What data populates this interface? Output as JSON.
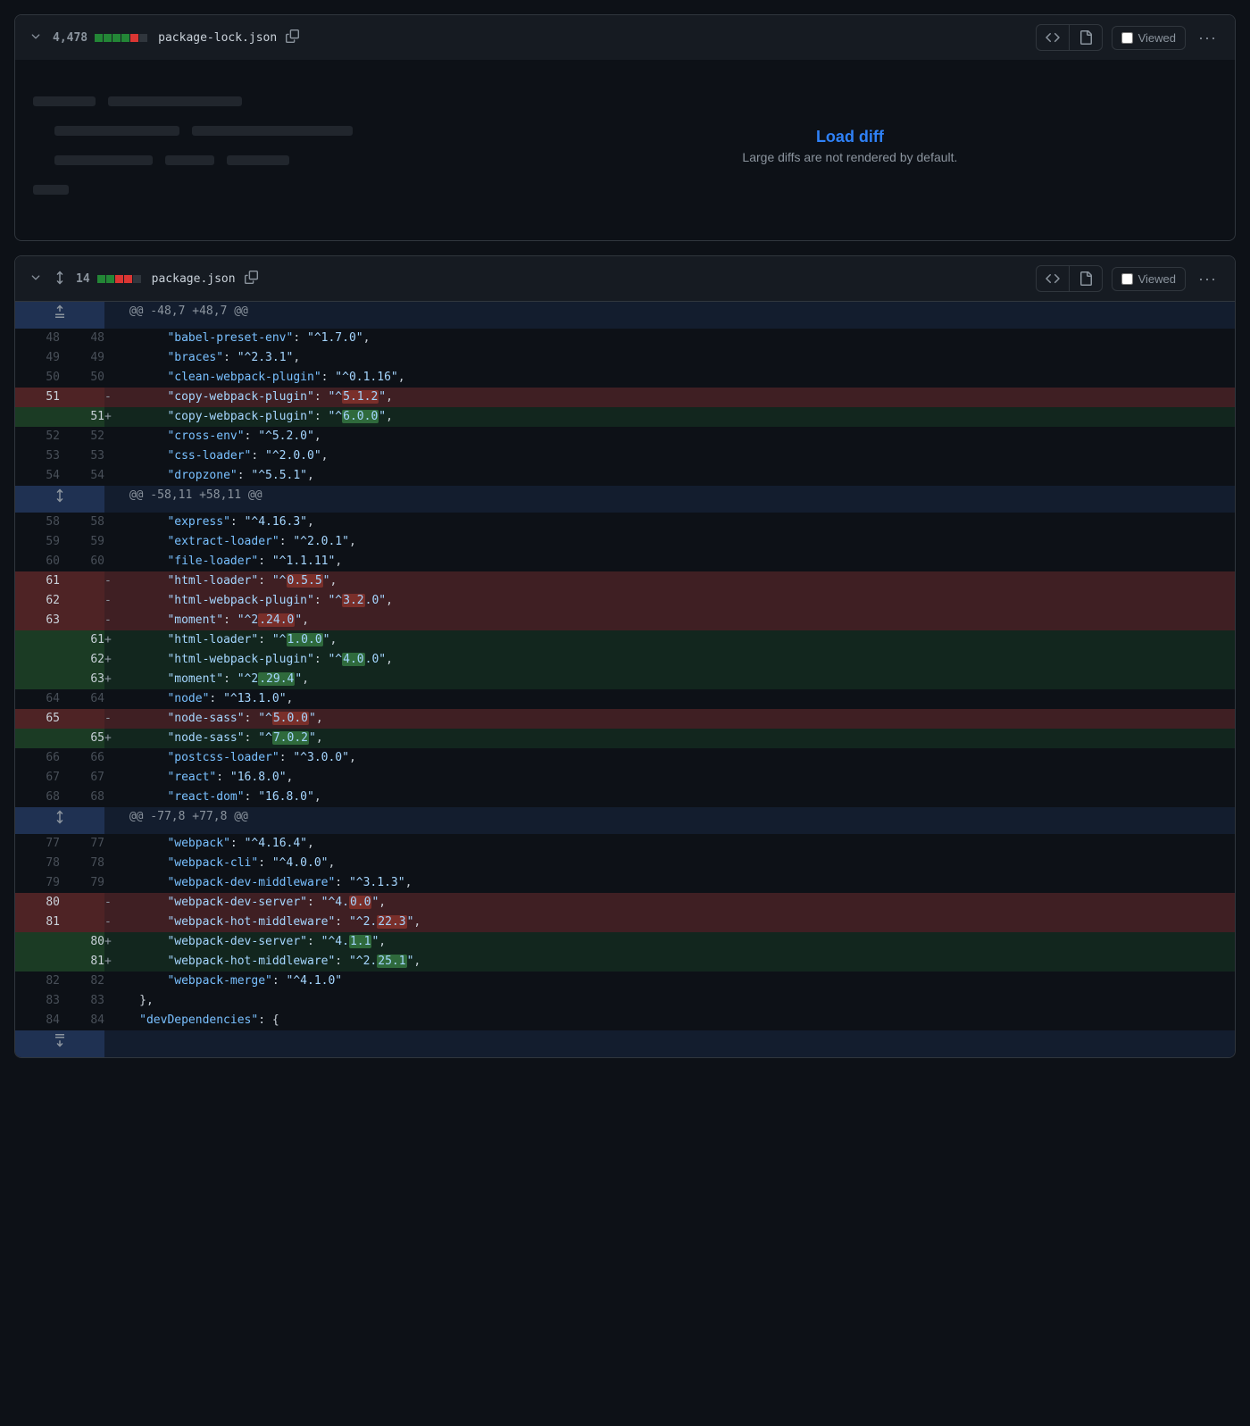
{
  "files": [
    {
      "changes": "4,478",
      "bars": [
        "green",
        "green",
        "green",
        "green",
        "red",
        "gray"
      ],
      "name": "package-lock.json",
      "collapsed": true,
      "load_diff": {
        "link": "Load diff",
        "subtext": "Large diffs are not rendered by default."
      }
    },
    {
      "changes": "14",
      "bars": [
        "green",
        "green",
        "red",
        "red",
        "gray"
      ],
      "name": "package.json",
      "collapsed": false
    }
  ],
  "viewed_label": "Viewed",
  "hunks": [
    {
      "header": "@@ -48,7 +48,7 @@",
      "expand_dir": "up",
      "lines": [
        {
          "type": "ctx",
          "lnL": "48",
          "lnR": "48",
          "code": "        \"babel-preset-env\": \"^1.7.0\","
        },
        {
          "type": "ctx",
          "lnL": "49",
          "lnR": "49",
          "code": "        \"braces\": \"^2.3.1\","
        },
        {
          "type": "ctx",
          "lnL": "50",
          "lnR": "50",
          "code": "        \"clean-webpack-plugin\": \"^0.1.16\","
        },
        {
          "type": "del",
          "lnL": "51",
          "lnR": "",
          "code": "        \"copy-webpack-plugin\": \"^{5.1.2}\","
        },
        {
          "type": "add",
          "lnL": "",
          "lnR": "51",
          "code": "        \"copy-webpack-plugin\": \"^{6.0.0}\","
        },
        {
          "type": "ctx",
          "lnL": "52",
          "lnR": "52",
          "code": "        \"cross-env\": \"^5.2.0\","
        },
        {
          "type": "ctx",
          "lnL": "53",
          "lnR": "53",
          "code": "        \"css-loader\": \"^2.0.0\","
        },
        {
          "type": "ctx",
          "lnL": "54",
          "lnR": "54",
          "code": "        \"dropzone\": \"^5.5.1\","
        }
      ]
    },
    {
      "header": "@@ -58,11 +58,11 @@",
      "expand_dir": "both",
      "lines": [
        {
          "type": "ctx",
          "lnL": "58",
          "lnR": "58",
          "code": "        \"express\": \"^4.16.3\","
        },
        {
          "type": "ctx",
          "lnL": "59",
          "lnR": "59",
          "code": "        \"extract-loader\": \"^2.0.1\","
        },
        {
          "type": "ctx",
          "lnL": "60",
          "lnR": "60",
          "code": "        \"file-loader\": \"^1.1.11\","
        },
        {
          "type": "del",
          "lnL": "61",
          "lnR": "",
          "code": "        \"html-loader\": \"^{0.5.5}\","
        },
        {
          "type": "del",
          "lnL": "62",
          "lnR": "",
          "code": "        \"html-webpack-plugin\": \"^{3.2}.0\","
        },
        {
          "type": "del",
          "lnL": "63",
          "lnR": "",
          "code": "        \"moment\": \"^2{.24.0}\","
        },
        {
          "type": "add",
          "lnL": "",
          "lnR": "61",
          "code": "        \"html-loader\": \"^{1.0.0}\","
        },
        {
          "type": "add",
          "lnL": "",
          "lnR": "62",
          "code": "        \"html-webpack-plugin\": \"^{4.0}.0\","
        },
        {
          "type": "add",
          "lnL": "",
          "lnR": "63",
          "code": "        \"moment\": \"^2{.29.4}\","
        },
        {
          "type": "ctx",
          "lnL": "64",
          "lnR": "64",
          "code": "        \"node\": \"^13.1.0\","
        },
        {
          "type": "del",
          "lnL": "65",
          "lnR": "",
          "code": "        \"node-sass\": \"^{5.0.0}\","
        },
        {
          "type": "add",
          "lnL": "",
          "lnR": "65",
          "code": "        \"node-sass\": \"^{7.0.2}\","
        },
        {
          "type": "ctx",
          "lnL": "66",
          "lnR": "66",
          "code": "        \"postcss-loader\": \"^3.0.0\","
        },
        {
          "type": "ctx",
          "lnL": "67",
          "lnR": "67",
          "code": "        \"react\": \"16.8.0\","
        },
        {
          "type": "ctx",
          "lnL": "68",
          "lnR": "68",
          "code": "        \"react-dom\": \"16.8.0\","
        }
      ]
    },
    {
      "header": "@@ -77,8 +77,8 @@",
      "expand_dir": "both",
      "lines": [
        {
          "type": "ctx",
          "lnL": "77",
          "lnR": "77",
          "code": "        \"webpack\": \"^4.16.4\","
        },
        {
          "type": "ctx",
          "lnL": "78",
          "lnR": "78",
          "code": "        \"webpack-cli\": \"^4.0.0\","
        },
        {
          "type": "ctx",
          "lnL": "79",
          "lnR": "79",
          "code": "        \"webpack-dev-middleware\": \"^3.1.3\","
        },
        {
          "type": "del",
          "lnL": "80",
          "lnR": "",
          "code": "        \"webpack-dev-server\": \"^4.{0.0}\","
        },
        {
          "type": "del",
          "lnL": "81",
          "lnR": "",
          "code": "        \"webpack-hot-middleware\": \"^2.{22.3}\","
        },
        {
          "type": "add",
          "lnL": "",
          "lnR": "80",
          "code": "        \"webpack-dev-server\": \"^4.{1.1}\","
        },
        {
          "type": "add",
          "lnL": "",
          "lnR": "81",
          "code": "        \"webpack-hot-middleware\": \"^2.{25.1}\","
        },
        {
          "type": "ctx",
          "lnL": "82",
          "lnR": "82",
          "code": "        \"webpack-merge\": \"^4.1.0\""
        },
        {
          "type": "ctx",
          "lnL": "83",
          "lnR": "83",
          "code": "    },"
        },
        {
          "type": "ctx",
          "lnL": "84",
          "lnR": "84",
          "code": "    \"devDependencies\": {"
        }
      ]
    }
  ],
  "final_expand_dir": "down"
}
